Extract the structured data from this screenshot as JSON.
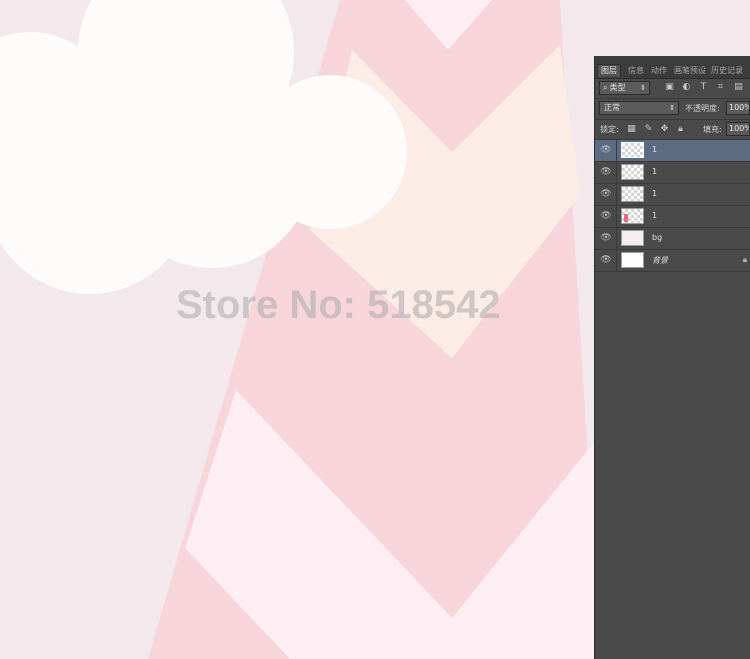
{
  "canvas": {
    "watermark": "Store No: 518542",
    "colors": {
      "background": "#f3e9ec",
      "pink": "#f7d5db",
      "light_pink": "#fceef2",
      "peach": "#fcece6",
      "cloud": "#fdfcfb"
    }
  },
  "panel": {
    "tabs": [
      {
        "label": "图层",
        "active": true
      },
      {
        "label": "信息",
        "active": false
      },
      {
        "label": "动作",
        "active": false
      },
      {
        "label": "画笔预设",
        "active": false
      },
      {
        "label": "历史记录",
        "active": false
      }
    ],
    "filter": {
      "label": "类型",
      "icons": [
        "image-filter-icon",
        "adjustment-filter-icon",
        "type-filter-icon",
        "shape-filter-icon",
        "smart-object-filter-icon"
      ]
    },
    "blend_mode": "正常",
    "opacity_label": "不透明度:",
    "opacity_value": "100%",
    "lock_label": "锁定:",
    "lock_icons": [
      "lock-transparent-pixels-icon",
      "lock-image-pixels-icon",
      "lock-position-icon",
      "lock-all-icon"
    ],
    "fill_label": "填充:",
    "fill_value": "100%",
    "layers": [
      {
        "name": "1",
        "selected": true,
        "visible": true
      },
      {
        "name": "1",
        "selected": false,
        "visible": true
      },
      {
        "name": "1",
        "selected": false,
        "visible": true
      },
      {
        "name": "1",
        "selected": false,
        "visible": true
      },
      {
        "name": "bg",
        "selected": false,
        "visible": true
      },
      {
        "name": "背景",
        "selected": false,
        "visible": true,
        "locked": true
      }
    ]
  }
}
